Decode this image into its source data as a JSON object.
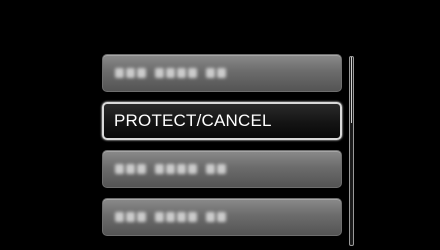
{
  "menu": {
    "items": [
      {
        "label": "",
        "blurred": true,
        "selected": false
      },
      {
        "label": "PROTECT/CANCEL",
        "blurred": false,
        "selected": true
      },
      {
        "label": "",
        "blurred": true,
        "selected": false
      },
      {
        "label": "",
        "blurred": true,
        "selected": false
      }
    ]
  },
  "scrollbar": {
    "position_fraction": 0.0,
    "visible_fraction": 0.35
  },
  "colors": {
    "background": "#000000",
    "item_fill": "#6c6c6c",
    "selected_fill": "#141414",
    "selected_border": "#d9d9d9",
    "text": "#ffffff"
  }
}
